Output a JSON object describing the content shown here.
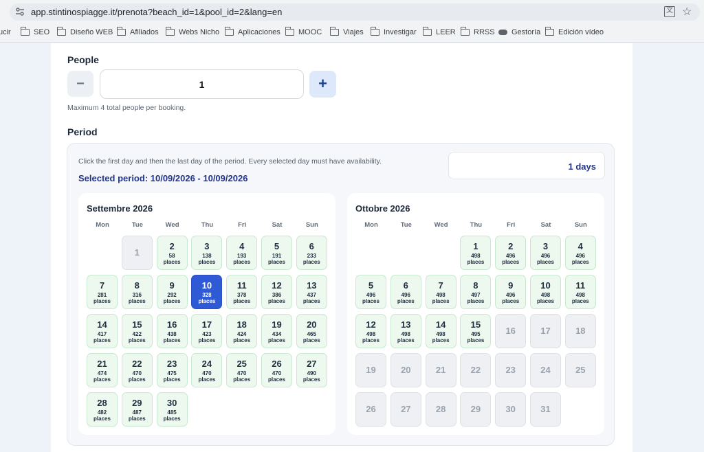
{
  "browser": {
    "url": "app.stintinospiagge.it/prenota?beach_id=1&pool_id=2&lang=en",
    "bookmarks": [
      "ucir",
      "SEO",
      "Diseño WEB",
      "Afiliados",
      "Webs Nicho",
      "Aplicaciones",
      "MOOC",
      "Viajes",
      "Investigar",
      "LEER",
      "RRSS",
      "Gestoría",
      "Edición vídeo"
    ]
  },
  "people": {
    "label": "People",
    "minus": "−",
    "value": "1",
    "plus": "+",
    "hint": "Maximum 4 total people per booking."
  },
  "period": {
    "label": "Period",
    "instruction": "Click the first day and then the last day of the period. Every selected day must have availability.",
    "selected": "Selected period: 10/09/2026 - 10/09/2026",
    "days": "1 days"
  },
  "weekdays": [
    "Mon",
    "Tue",
    "Wed",
    "Thu",
    "Fri",
    "Sat",
    "Sun"
  ],
  "calendars": [
    {
      "title": "Settembre 2026",
      "first_col": 1,
      "days": [
        {
          "d": "1",
          "status": "unavailable"
        },
        {
          "d": "2",
          "places": "58",
          "unit": "places"
        },
        {
          "d": "3",
          "places": "138",
          "unit": "places"
        },
        {
          "d": "4",
          "places": "193",
          "unit": "places"
        },
        {
          "d": "5",
          "places": "191",
          "unit": "places"
        },
        {
          "d": "6",
          "places": "233",
          "unit": "places"
        },
        {
          "d": "7",
          "places": "281",
          "unit": "places"
        },
        {
          "d": "8",
          "places": "316",
          "unit": "places"
        },
        {
          "d": "9",
          "places": "292",
          "unit": "places"
        },
        {
          "d": "10",
          "places": "328",
          "unit": "places",
          "status": "selected"
        },
        {
          "d": "11",
          "places": "378",
          "unit": "places"
        },
        {
          "d": "12",
          "places": "386",
          "unit": "places"
        },
        {
          "d": "13",
          "places": "437",
          "unit": "places"
        },
        {
          "d": "14",
          "places": "417",
          "unit": "places"
        },
        {
          "d": "15",
          "places": "422",
          "unit": "places"
        },
        {
          "d": "16",
          "places": "438",
          "unit": "places"
        },
        {
          "d": "17",
          "places": "423",
          "unit": "places"
        },
        {
          "d": "18",
          "places": "424",
          "unit": "places"
        },
        {
          "d": "19",
          "places": "434",
          "unit": "places"
        },
        {
          "d": "20",
          "places": "465",
          "unit": "places"
        },
        {
          "d": "21",
          "places": "474",
          "unit": "places"
        },
        {
          "d": "22",
          "places": "470",
          "unit": "places"
        },
        {
          "d": "23",
          "places": "475",
          "unit": "places"
        },
        {
          "d": "24",
          "places": "470",
          "unit": "places"
        },
        {
          "d": "25",
          "places": "470",
          "unit": "places"
        },
        {
          "d": "26",
          "places": "470",
          "unit": "places"
        },
        {
          "d": "27",
          "places": "490",
          "unit": "places"
        },
        {
          "d": "28",
          "places": "482",
          "unit": "places"
        },
        {
          "d": "29",
          "places": "487",
          "unit": "places"
        },
        {
          "d": "30",
          "places": "485",
          "unit": "places"
        }
      ]
    },
    {
      "title": "Ottobre 2026",
      "first_col": 3,
      "days": [
        {
          "d": "1",
          "places": "498",
          "unit": "places"
        },
        {
          "d": "2",
          "places": "496",
          "unit": "places"
        },
        {
          "d": "3",
          "places": "496",
          "unit": "places"
        },
        {
          "d": "4",
          "places": "496",
          "unit": "places"
        },
        {
          "d": "5",
          "places": "496",
          "unit": "places"
        },
        {
          "d": "6",
          "places": "496",
          "unit": "places"
        },
        {
          "d": "7",
          "places": "498",
          "unit": "places"
        },
        {
          "d": "8",
          "places": "497",
          "unit": "places"
        },
        {
          "d": "9",
          "places": "496",
          "unit": "places"
        },
        {
          "d": "10",
          "places": "498",
          "unit": "places"
        },
        {
          "d": "11",
          "places": "498",
          "unit": "places"
        },
        {
          "d": "12",
          "places": "498",
          "unit": "places"
        },
        {
          "d": "13",
          "places": "498",
          "unit": "places"
        },
        {
          "d": "14",
          "places": "498",
          "unit": "places"
        },
        {
          "d": "15",
          "places": "495",
          "unit": "places"
        },
        {
          "d": "16",
          "status": "unavailable"
        },
        {
          "d": "17",
          "status": "unavailable"
        },
        {
          "d": "18",
          "status": "unavailable"
        },
        {
          "d": "19",
          "status": "unavailable"
        },
        {
          "d": "20",
          "status": "unavailable"
        },
        {
          "d": "21",
          "status": "unavailable"
        },
        {
          "d": "22",
          "status": "unavailable"
        },
        {
          "d": "23",
          "status": "unavailable"
        },
        {
          "d": "24",
          "status": "unavailable"
        },
        {
          "d": "25",
          "status": "unavailable"
        },
        {
          "d": "26",
          "status": "unavailable"
        },
        {
          "d": "27",
          "status": "unavailable"
        },
        {
          "d": "28",
          "status": "unavailable"
        },
        {
          "d": "29",
          "status": "unavailable"
        },
        {
          "d": "30",
          "status": "unavailable"
        },
        {
          "d": "31",
          "status": "unavailable"
        }
      ]
    }
  ],
  "colors": {
    "accent": "#2e5ad6",
    "available_bg": "#edf8ef",
    "unavailable_bg": "#eef0f3",
    "heading_blue": "#22358a"
  }
}
